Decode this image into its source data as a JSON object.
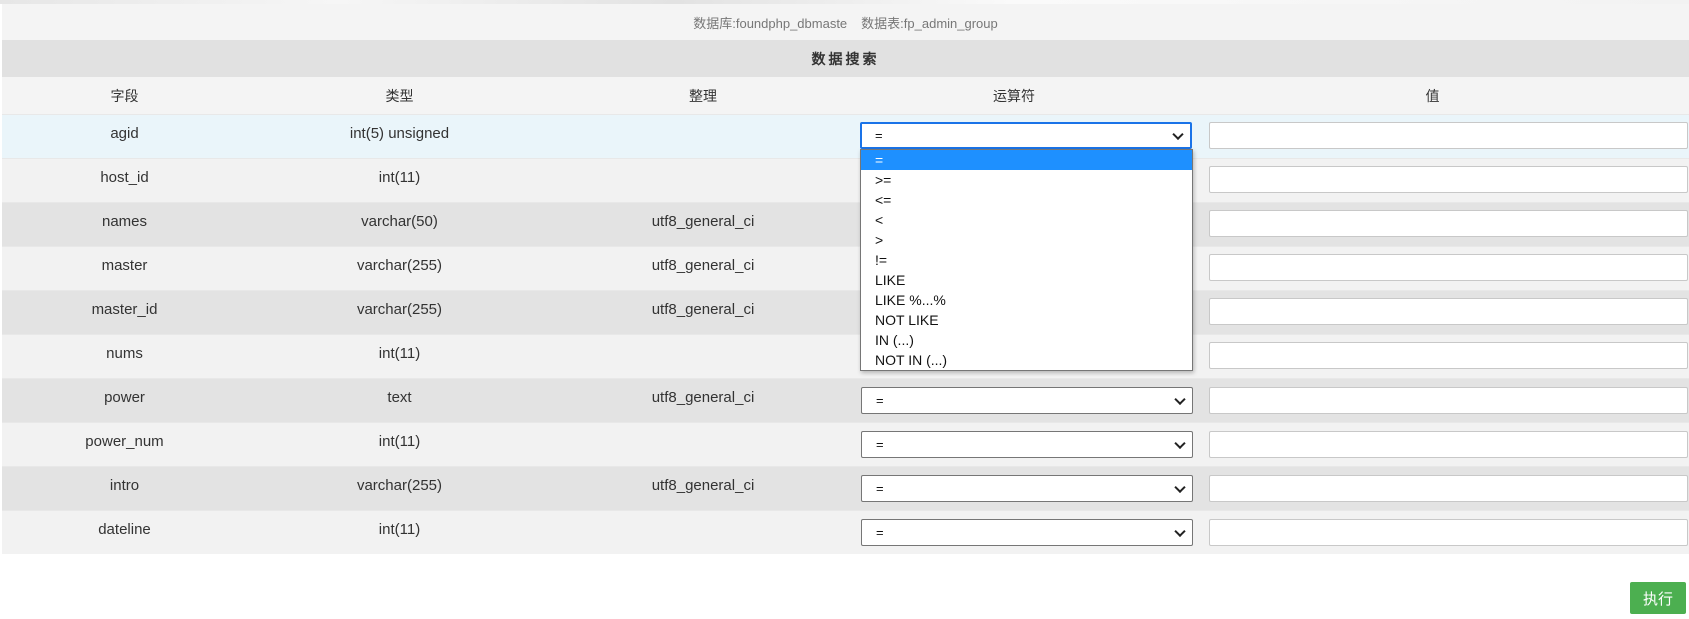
{
  "info": {
    "database": "数据库:foundphp_dbmaste",
    "table": "数据表:fp_admin_group"
  },
  "title": "数据搜索",
  "headers": {
    "field": "字段",
    "type": "类型",
    "collation": "整理",
    "operator": "运算符",
    "value": "值"
  },
  "rows": [
    {
      "field": "agid",
      "type": "int(5) unsigned",
      "collation": "",
      "operator": "="
    },
    {
      "field": "host_id",
      "type": "int(11)",
      "collation": "",
      "operator": "="
    },
    {
      "field": "names",
      "type": "varchar(50)",
      "collation": "utf8_general_ci",
      "operator": "="
    },
    {
      "field": "master",
      "type": "varchar(255)",
      "collation": "utf8_general_ci",
      "operator": "="
    },
    {
      "field": "master_id",
      "type": "varchar(255)",
      "collation": "utf8_general_ci",
      "operator": "="
    },
    {
      "field": "nums",
      "type": "int(11)",
      "collation": "",
      "operator": "="
    },
    {
      "field": "power",
      "type": "text",
      "collation": "utf8_general_ci",
      "operator": "="
    },
    {
      "field": "power_num",
      "type": "int(11)",
      "collation": "",
      "operator": "="
    },
    {
      "field": "intro",
      "type": "varchar(255)",
      "collation": "utf8_general_ci",
      "operator": "="
    },
    {
      "field": "dateline",
      "type": "int(11)",
      "collation": "",
      "operator": "="
    }
  ],
  "dropdown_options": [
    "=",
    ">=",
    "<=",
    "<",
    ">",
    "!=",
    "LIKE",
    "LIKE %...%",
    "NOT LIKE",
    "IN (...)",
    "NOT IN (...)"
  ],
  "execute_label": "执行",
  "colors": {
    "accent": "#1e90ff",
    "execute": "#4caf50"
  }
}
